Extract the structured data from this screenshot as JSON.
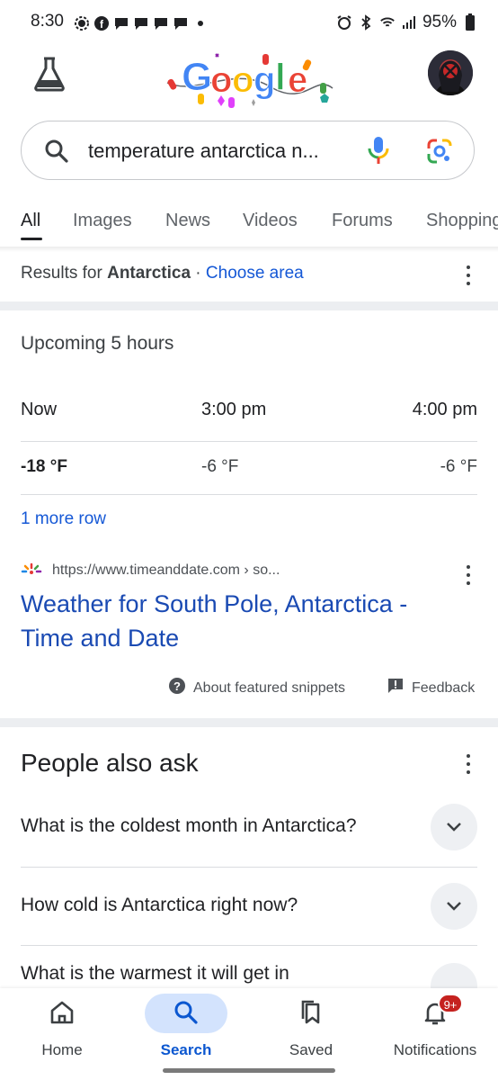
{
  "status_bar": {
    "time": "8:30",
    "battery": "95%"
  },
  "search": {
    "query": "temperature antarctica n..."
  },
  "tabs": [
    {
      "label": "All"
    },
    {
      "label": "Images"
    },
    {
      "label": "News"
    },
    {
      "label": "Videos"
    },
    {
      "label": "Forums"
    },
    {
      "label": "Shopping"
    }
  ],
  "results_for": {
    "prefix": "Results for ",
    "place": "Antarctica",
    "separator": " · ",
    "link": "Choose area"
  },
  "weather": {
    "heading": "Upcoming 5 hours",
    "times": [
      "Now",
      "3:00 pm",
      "4:00 pm"
    ],
    "temps": [
      "-18 °F",
      "-6 °F",
      "-6 °F"
    ],
    "more_row": "1 more row"
  },
  "featured_result": {
    "url": "https://www.timeanddate.com › so...",
    "title": "Weather for South Pole, Antarctica - Time and Date",
    "about_snippets": "About featured snippets",
    "feedback": "Feedback"
  },
  "people_also_ask": {
    "heading": "People also ask",
    "questions": [
      "What is the coldest month in Antarctica?",
      "How cold is Antarctica right now?",
      "What is the warmest it will get in"
    ]
  },
  "bottom_nav": {
    "items": [
      {
        "label": "Home"
      },
      {
        "label": "Search"
      },
      {
        "label": "Saved"
      },
      {
        "label": "Notifications"
      }
    ],
    "notifications_badge": "9+"
  },
  "colors": {
    "link": "#1a4ab3",
    "accent": "#1558d6",
    "search_pill": "#d3e3fd",
    "badge": "#c5221f"
  }
}
